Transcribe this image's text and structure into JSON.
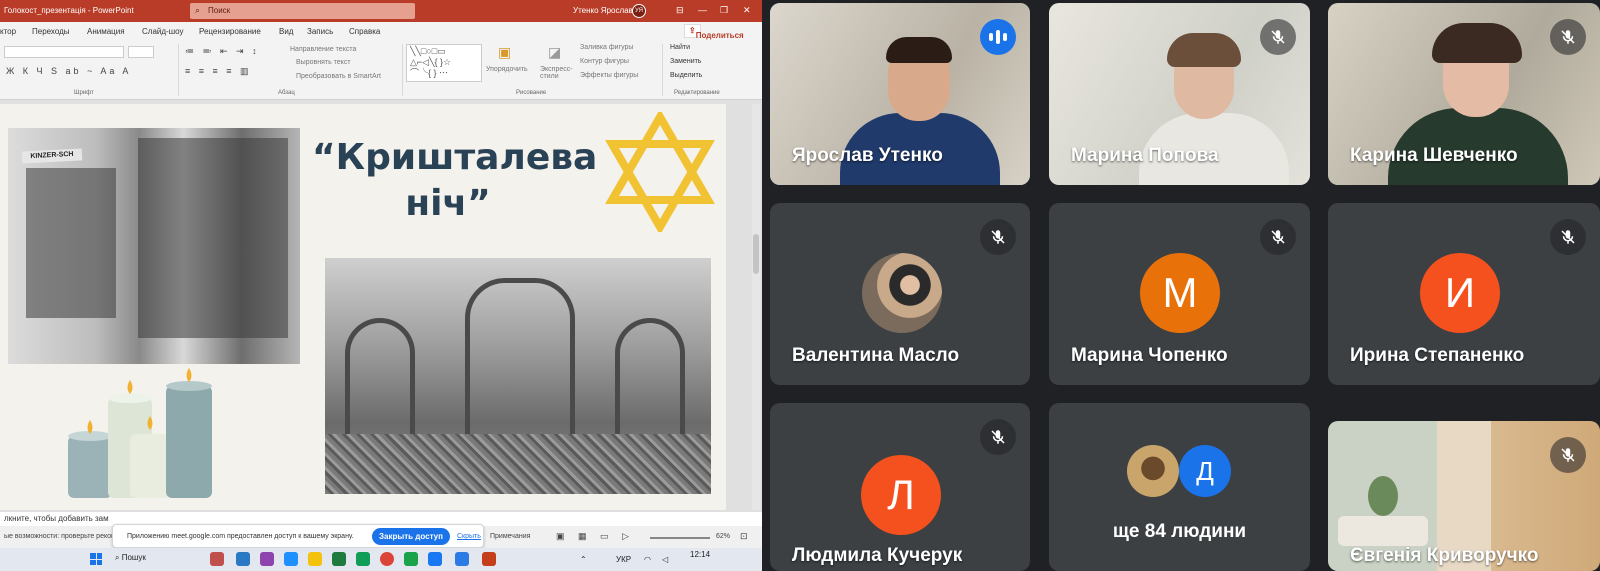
{
  "powerpoint": {
    "file_name": "Голокост_презентація  -  PowerPoint",
    "search_placeholder": "Поиск",
    "user_name": "Утенко Ярослав",
    "user_initials": "УЯ",
    "menu": [
      "ктор",
      "Переходы",
      "Анимация",
      "Слайд-шоу",
      "Рецензирование",
      "Вид",
      "Запись",
      "Справка"
    ],
    "share_label": "Поделиться",
    "ribbon": {
      "text_direction": "Направление текста",
      "align_text": "Выровнять текст",
      "smartart": "Преобразовать в SmartArt",
      "arrange": "Упорядочить",
      "styles": "Экспресс-стили",
      "fill": "Заливка фигуры",
      "outline": "Контур фигуры",
      "effects": "Эффекты фигуры",
      "find": "Найти",
      "replace": "Заменить",
      "select": "Выделить",
      "group_font": "Шрифт",
      "group_paragraph": "Абзац",
      "group_drawing": "Рисование",
      "group_editing": "Редактирование"
    },
    "slide": {
      "title_line1": "“Кришталева",
      "title_line2": "ніч”",
      "sign_text": "KINZER-SCH"
    },
    "notes_placeholder": "лкните, чтобы добавить зам",
    "status_left": "ые возможности: проверьте рекоменда...",
    "status_notes": "Примечания",
    "zoom": "62%",
    "toast": {
      "text": "Приложению meet.google.com предоставлен доступ к вашему экрану.",
      "button": "Закрыть доступ",
      "hide": "Скрыть"
    },
    "taskbar": {
      "search": "Пошук",
      "lang": "УКР",
      "time": "12:14"
    }
  },
  "meet": {
    "colors": {
      "tile": "#3c4043",
      "active_border": "#8ab4f8",
      "speaking": "#1a73e8",
      "avatar_orange": "#e8710a",
      "avatar_red": "#f4511e",
      "avatar_blue": "#1a73e8"
    },
    "participants": [
      {
        "name": "Ярослав Утенко",
        "kind": "video",
        "speaking": true
      },
      {
        "name": "Марина Попова",
        "kind": "video",
        "muted": true
      },
      {
        "name": "Карина Шевченко",
        "kind": "video",
        "muted": true
      },
      {
        "name": "Валентина Масло",
        "kind": "photo",
        "muted": true
      },
      {
        "name": "Марина Чопенко",
        "kind": "letter",
        "letter": "М",
        "muted": true
      },
      {
        "name": "Ирина Степаненко",
        "kind": "letter",
        "letter": "И",
        "muted": true
      },
      {
        "name": "Людмила Кучерук",
        "kind": "letter",
        "letter": "Л",
        "muted": true
      },
      {
        "name": "ще 84 людини",
        "kind": "overflow",
        "letter": "Д"
      },
      {
        "name": "Євгенія Криворучко",
        "kind": "video",
        "muted": true
      }
    ]
  }
}
